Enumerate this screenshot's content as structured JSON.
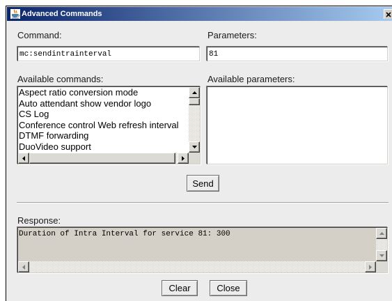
{
  "window": {
    "title": "Advanced Commands",
    "app_icon": "java-cup-icon",
    "close_icon": "close-icon"
  },
  "command": {
    "label": "Command:",
    "value": "mc:sendintrainterval"
  },
  "parameters": {
    "label": "Parameters:",
    "value": "81"
  },
  "available_commands": {
    "label": "Available commands:",
    "items": [
      "Aspect ratio conversion mode",
      "Auto attendant show vendor logo",
      "CS Log",
      "Conference control Web refresh interval",
      "DTMF forwarding",
      "DuoVideo support"
    ]
  },
  "available_parameters": {
    "label": "Available parameters:",
    "items": []
  },
  "send_button": {
    "label": "Send"
  },
  "response": {
    "label": "Response:",
    "text": "Duration of Intra Interval for service 81: 300"
  },
  "footer": {
    "clear_label": "Clear",
    "close_label": "Close"
  },
  "scrollbar_icons": {
    "up": "arrow-up-icon",
    "down": "arrow-down-icon",
    "left": "arrow-left-icon",
    "right": "arrow-right-icon"
  },
  "colors": {
    "title_bar_start": "#0a246a",
    "title_bar_end": "#a6caf0",
    "title_text": "#ffffff",
    "dialog_bg": "#ececec",
    "response_bg": "#d4d0c8",
    "list_bg": "#ffffff"
  }
}
